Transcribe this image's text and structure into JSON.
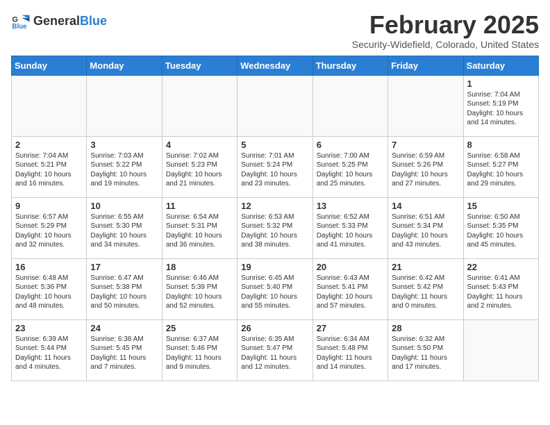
{
  "header": {
    "logo_general": "General",
    "logo_blue": "Blue",
    "title": "February 2025",
    "subtitle": "Security-Widefield, Colorado, United States"
  },
  "days_of_week": [
    "Sunday",
    "Monday",
    "Tuesday",
    "Wednesday",
    "Thursday",
    "Friday",
    "Saturday"
  ],
  "weeks": [
    [
      {
        "day": "",
        "info": ""
      },
      {
        "day": "",
        "info": ""
      },
      {
        "day": "",
        "info": ""
      },
      {
        "day": "",
        "info": ""
      },
      {
        "day": "",
        "info": ""
      },
      {
        "day": "",
        "info": ""
      },
      {
        "day": "1",
        "info": "Sunrise: 7:04 AM\nSunset: 5:19 PM\nDaylight: 10 hours\nand 14 minutes."
      }
    ],
    [
      {
        "day": "2",
        "info": "Sunrise: 7:04 AM\nSunset: 5:21 PM\nDaylight: 10 hours\nand 16 minutes."
      },
      {
        "day": "3",
        "info": "Sunrise: 7:03 AM\nSunset: 5:22 PM\nDaylight: 10 hours\nand 19 minutes."
      },
      {
        "day": "4",
        "info": "Sunrise: 7:02 AM\nSunset: 5:23 PM\nDaylight: 10 hours\nand 21 minutes."
      },
      {
        "day": "5",
        "info": "Sunrise: 7:01 AM\nSunset: 5:24 PM\nDaylight: 10 hours\nand 23 minutes."
      },
      {
        "day": "6",
        "info": "Sunrise: 7:00 AM\nSunset: 5:25 PM\nDaylight: 10 hours\nand 25 minutes."
      },
      {
        "day": "7",
        "info": "Sunrise: 6:59 AM\nSunset: 5:26 PM\nDaylight: 10 hours\nand 27 minutes."
      },
      {
        "day": "8",
        "info": "Sunrise: 6:58 AM\nSunset: 5:27 PM\nDaylight: 10 hours\nand 29 minutes."
      }
    ],
    [
      {
        "day": "9",
        "info": "Sunrise: 6:57 AM\nSunset: 5:29 PM\nDaylight: 10 hours\nand 32 minutes."
      },
      {
        "day": "10",
        "info": "Sunrise: 6:55 AM\nSunset: 5:30 PM\nDaylight: 10 hours\nand 34 minutes."
      },
      {
        "day": "11",
        "info": "Sunrise: 6:54 AM\nSunset: 5:31 PM\nDaylight: 10 hours\nand 36 minutes."
      },
      {
        "day": "12",
        "info": "Sunrise: 6:53 AM\nSunset: 5:32 PM\nDaylight: 10 hours\nand 38 minutes."
      },
      {
        "day": "13",
        "info": "Sunrise: 6:52 AM\nSunset: 5:33 PM\nDaylight: 10 hours\nand 41 minutes."
      },
      {
        "day": "14",
        "info": "Sunrise: 6:51 AM\nSunset: 5:34 PM\nDaylight: 10 hours\nand 43 minutes."
      },
      {
        "day": "15",
        "info": "Sunrise: 6:50 AM\nSunset: 5:35 PM\nDaylight: 10 hours\nand 45 minutes."
      }
    ],
    [
      {
        "day": "16",
        "info": "Sunrise: 6:48 AM\nSunset: 5:36 PM\nDaylight: 10 hours\nand 48 minutes."
      },
      {
        "day": "17",
        "info": "Sunrise: 6:47 AM\nSunset: 5:38 PM\nDaylight: 10 hours\nand 50 minutes."
      },
      {
        "day": "18",
        "info": "Sunrise: 6:46 AM\nSunset: 5:39 PM\nDaylight: 10 hours\nand 52 minutes."
      },
      {
        "day": "19",
        "info": "Sunrise: 6:45 AM\nSunset: 5:40 PM\nDaylight: 10 hours\nand 55 minutes."
      },
      {
        "day": "20",
        "info": "Sunrise: 6:43 AM\nSunset: 5:41 PM\nDaylight: 10 hours\nand 57 minutes."
      },
      {
        "day": "21",
        "info": "Sunrise: 6:42 AM\nSunset: 5:42 PM\nDaylight: 11 hours\nand 0 minutes."
      },
      {
        "day": "22",
        "info": "Sunrise: 6:41 AM\nSunset: 5:43 PM\nDaylight: 11 hours\nand 2 minutes."
      }
    ],
    [
      {
        "day": "23",
        "info": "Sunrise: 6:39 AM\nSunset: 5:44 PM\nDaylight: 11 hours\nand 4 minutes."
      },
      {
        "day": "24",
        "info": "Sunrise: 6:38 AM\nSunset: 5:45 PM\nDaylight: 11 hours\nand 7 minutes."
      },
      {
        "day": "25",
        "info": "Sunrise: 6:37 AM\nSunset: 5:46 PM\nDaylight: 11 hours\nand 9 minutes."
      },
      {
        "day": "26",
        "info": "Sunrise: 6:35 AM\nSunset: 5:47 PM\nDaylight: 11 hours\nand 12 minutes."
      },
      {
        "day": "27",
        "info": "Sunrise: 6:34 AM\nSunset: 5:48 PM\nDaylight: 11 hours\nand 14 minutes."
      },
      {
        "day": "28",
        "info": "Sunrise: 6:32 AM\nSunset: 5:50 PM\nDaylight: 11 hours\nand 17 minutes."
      },
      {
        "day": "",
        "info": ""
      }
    ]
  ]
}
